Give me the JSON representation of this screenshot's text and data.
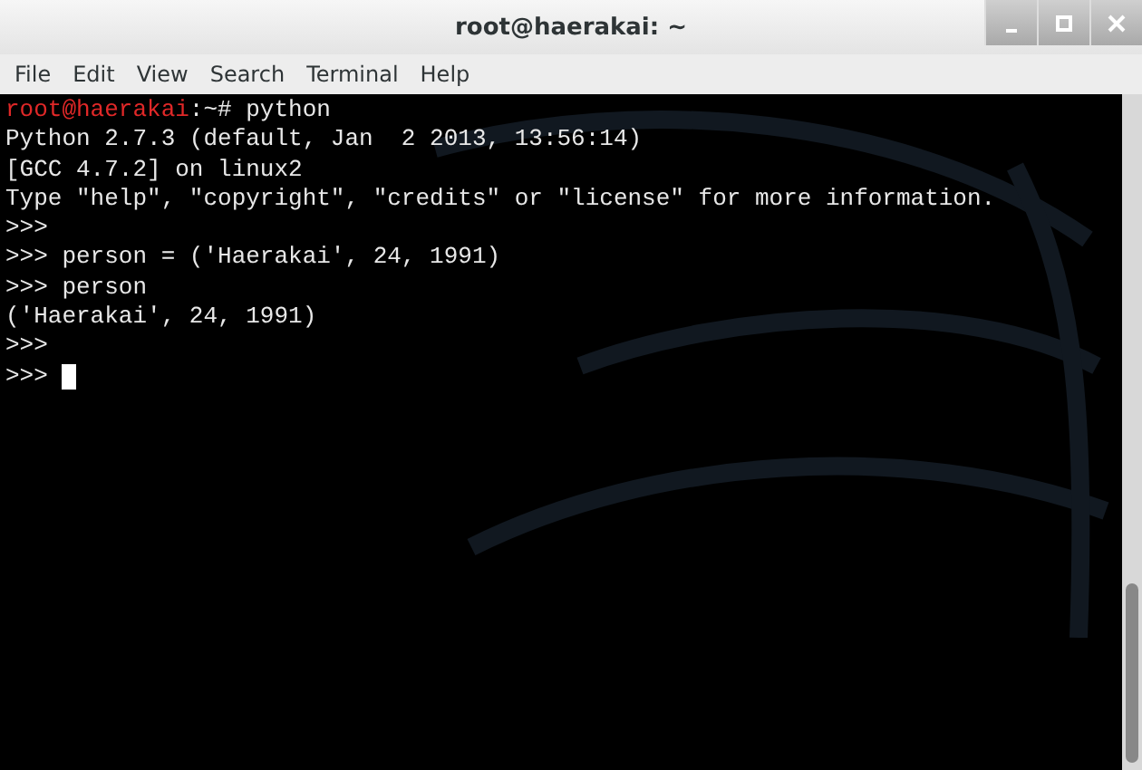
{
  "window": {
    "title": "root@haerakai: ~"
  },
  "menu": [
    "File",
    "Edit",
    "View",
    "Search",
    "Terminal",
    "Help"
  ],
  "terminal": {
    "lines": [
      {
        "kind": "prompt",
        "user_host": "root@haerakai",
        "rest": ":~# python"
      },
      {
        "kind": "output",
        "text": "Python 2.7.3 (default, Jan  2 2013, 13:56:14)"
      },
      {
        "kind": "output",
        "text": "[GCC 4.7.2] on linux2"
      },
      {
        "kind": "output",
        "text": "Type \"help\", \"copyright\", \"credits\" or \"license\" for more information."
      },
      {
        "kind": "output",
        "text": ">>>"
      },
      {
        "kind": "output",
        "text": ">>> person = ('Haerakai', 24, 1991)"
      },
      {
        "kind": "output",
        "text": ">>> person"
      },
      {
        "kind": "output",
        "text": "('Haerakai', 24, 1991)"
      },
      {
        "kind": "output",
        "text": ">>>"
      },
      {
        "kind": "input",
        "text": ">>>",
        "cursor": true
      }
    ]
  }
}
